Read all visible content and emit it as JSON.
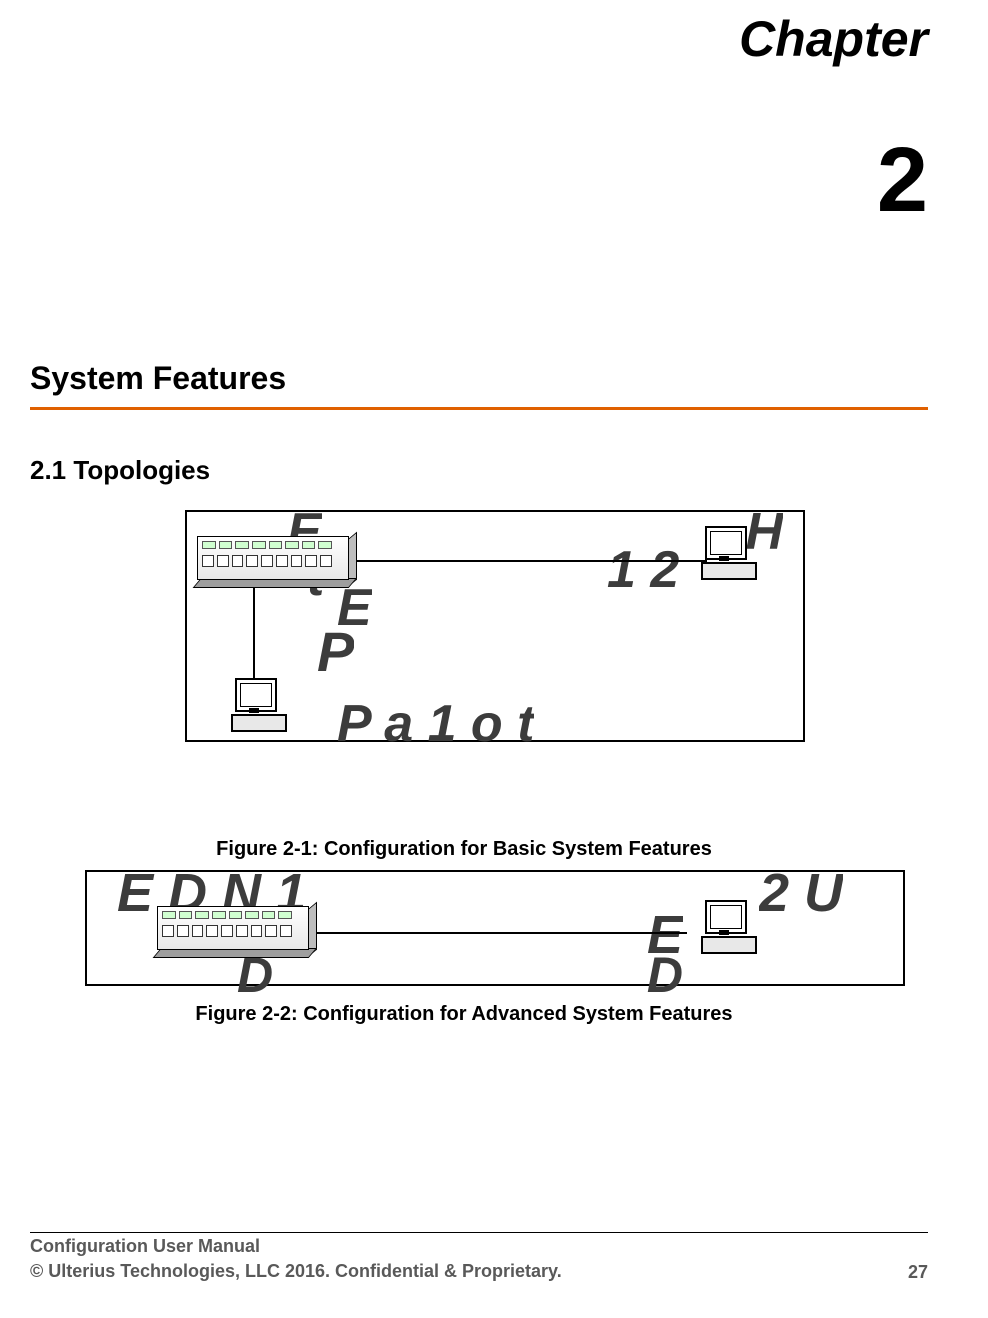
{
  "chapter": {
    "label": "Chapter",
    "number": "2"
  },
  "section": {
    "title": "System Features"
  },
  "subsection": {
    "number": "2.1",
    "title": "Topologies",
    "full": "2.1 Topologies"
  },
  "figures": {
    "fig1": {
      "caption": "Figure 2-1: Configuration for Basic System Features"
    },
    "fig2": {
      "caption": "Figure 2-2: Configuration for Advanced System Features"
    }
  },
  "footer": {
    "doc_title": "Configuration User Manual",
    "copyright": "© Ulterius Technologies, LLC 2016. Confidential & Proprietary.",
    "page_number": "27"
  }
}
